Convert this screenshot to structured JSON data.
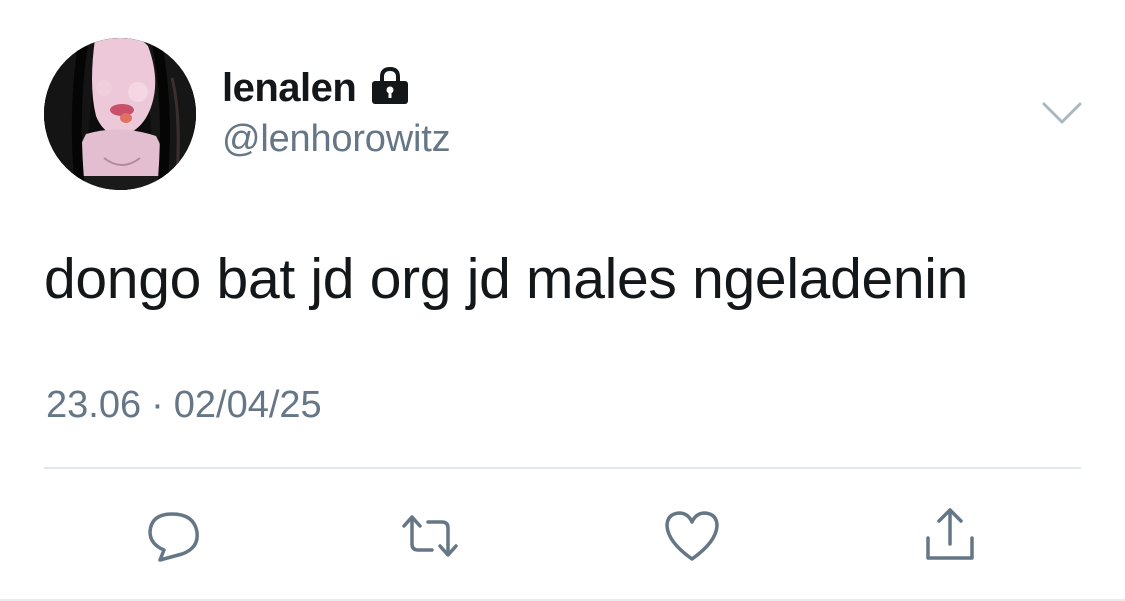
{
  "user": {
    "display_name": "lenalen",
    "handle": "@lenhorowitz",
    "protected_icon": "lock-icon",
    "avatar": "profile-photo"
  },
  "tweet": {
    "text": "dongo bat jd org jd males ngeladenin",
    "time": "23.06",
    "separator": "·",
    "date": "02/04/25"
  },
  "actions": {
    "menu_icon": "chevron-down-icon",
    "reply_icon": "reply-icon",
    "retweet_icon": "retweet-icon",
    "like_icon": "heart-icon",
    "share_icon": "share-icon"
  },
  "colors": {
    "text": "#14171a",
    "secondary": "#657786",
    "divider": "#e1e8ed",
    "icon": "#657786",
    "background": "#ffffff"
  }
}
